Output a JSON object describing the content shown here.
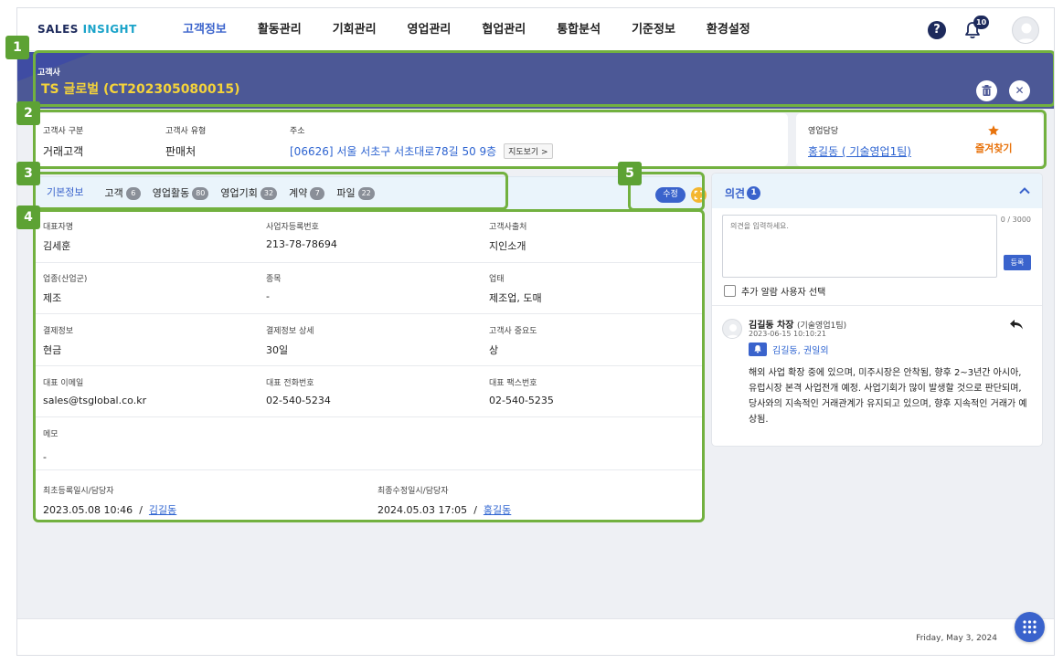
{
  "brand": {
    "logo_main": "SALES ",
    "logo_accent": "INSIGHT"
  },
  "nav": {
    "items": [
      {
        "label": "고객정보",
        "active": true
      },
      {
        "label": "활동관리"
      },
      {
        "label": "기회관리"
      },
      {
        "label": "영업관리"
      },
      {
        "label": "협업관리"
      },
      {
        "label": "통합분석"
      },
      {
        "label": "기준정보"
      },
      {
        "label": "환경설정"
      }
    ],
    "help_icon": "?",
    "notification_count": "10"
  },
  "header": {
    "label": "고객사",
    "title": "TS 글로벌 (CT202305080015)",
    "delete_icon": "🗑",
    "close_icon": "✕"
  },
  "summary": {
    "type_label": "고객사 구분",
    "type_value": "거래고객",
    "category_label": "고객사 유형",
    "category_value": "판매처",
    "address_label": "주소",
    "address_value": "[06626] 서울 서초구 서초대로78길 50 9층",
    "map_button": "지도보기 >",
    "manager_label": "영업담당",
    "manager_value": "홍길동 ( 기술영업1팀)",
    "favorite_label": "즐겨찾기"
  },
  "tabs": [
    {
      "label": "기본정보",
      "active": true
    },
    {
      "label": "고객",
      "count": "6"
    },
    {
      "label": "영업활동",
      "count": "80"
    },
    {
      "label": "영업기회",
      "count": "32"
    },
    {
      "label": "계약",
      "count": "7"
    },
    {
      "label": "파일",
      "count": "22"
    }
  ],
  "toolbar": {
    "edit_label": "수정"
  },
  "detail": {
    "rows": [
      [
        {
          "label": "대표자명",
          "value": "김세훈"
        },
        {
          "label": "사업자등록번호",
          "value": "213-78-78694"
        },
        {
          "label": "고객사출처",
          "value": "지인소개"
        }
      ],
      [
        {
          "label": "업종(산업군)",
          "value": "제조"
        },
        {
          "label": "종목",
          "value": "-"
        },
        {
          "label": "업태",
          "value": "제조업, 도매"
        }
      ],
      [
        {
          "label": "결제정보",
          "value": "현금"
        },
        {
          "label": "결제정보 상세",
          "value": "30일"
        },
        {
          "label": "고객사 중요도",
          "value": "상"
        }
      ],
      [
        {
          "label": "대표 이메일",
          "value": "sales@tsglobal.co.kr"
        },
        {
          "label": "대표 전화번호",
          "value": "02-540-5234"
        },
        {
          "label": "대표 팩스번호",
          "value": "02-540-5235"
        }
      ]
    ],
    "memo_label": "메모",
    "memo_value": "-",
    "created_label": "최초등록일시/담당자",
    "created_date": "2023.05.08 10:46",
    "created_sep": "/",
    "created_user": "김길동",
    "modified_label": "최종수정일시/담당자",
    "modified_date": "2024.05.03 17:05",
    "modified_sep": "/",
    "modified_user": "홍길동"
  },
  "comments": {
    "title": "의견",
    "count": "1",
    "placeholder": "의견을 입력하세요.",
    "char_count": "0 / 3000",
    "submit_label": "등록",
    "notify_label": "추가 알람 사용자 선택",
    "item": {
      "author": "김길동 차장",
      "team": "(기술영업1팀)",
      "date": "2023-06-15 10:10:21",
      "mentions": "김길동, 권일외",
      "body": "해외 사업 확장 중에 있으며, 미주시장은 안착됨, 향후 2~3년간 아시아, 유럽시장 본격 사업전개 예정. 사업기회가 많이 발생할 것으로 판단되며, 당사와의 지속적인 거래관계가 유지되고 있으며, 향후 지속적인 거래가 예상됨."
    }
  },
  "footer": {
    "date": "Friday, May 3, 2024"
  },
  "callouts": [
    "1",
    "2",
    "3",
    "4",
    "5"
  ],
  "colors": {
    "primary": "#3a63cc",
    "header_band": "#4c5896",
    "title_yellow": "#f4d33a",
    "favorite_orange": "#e8730c",
    "callout_green": "#72b13f"
  }
}
